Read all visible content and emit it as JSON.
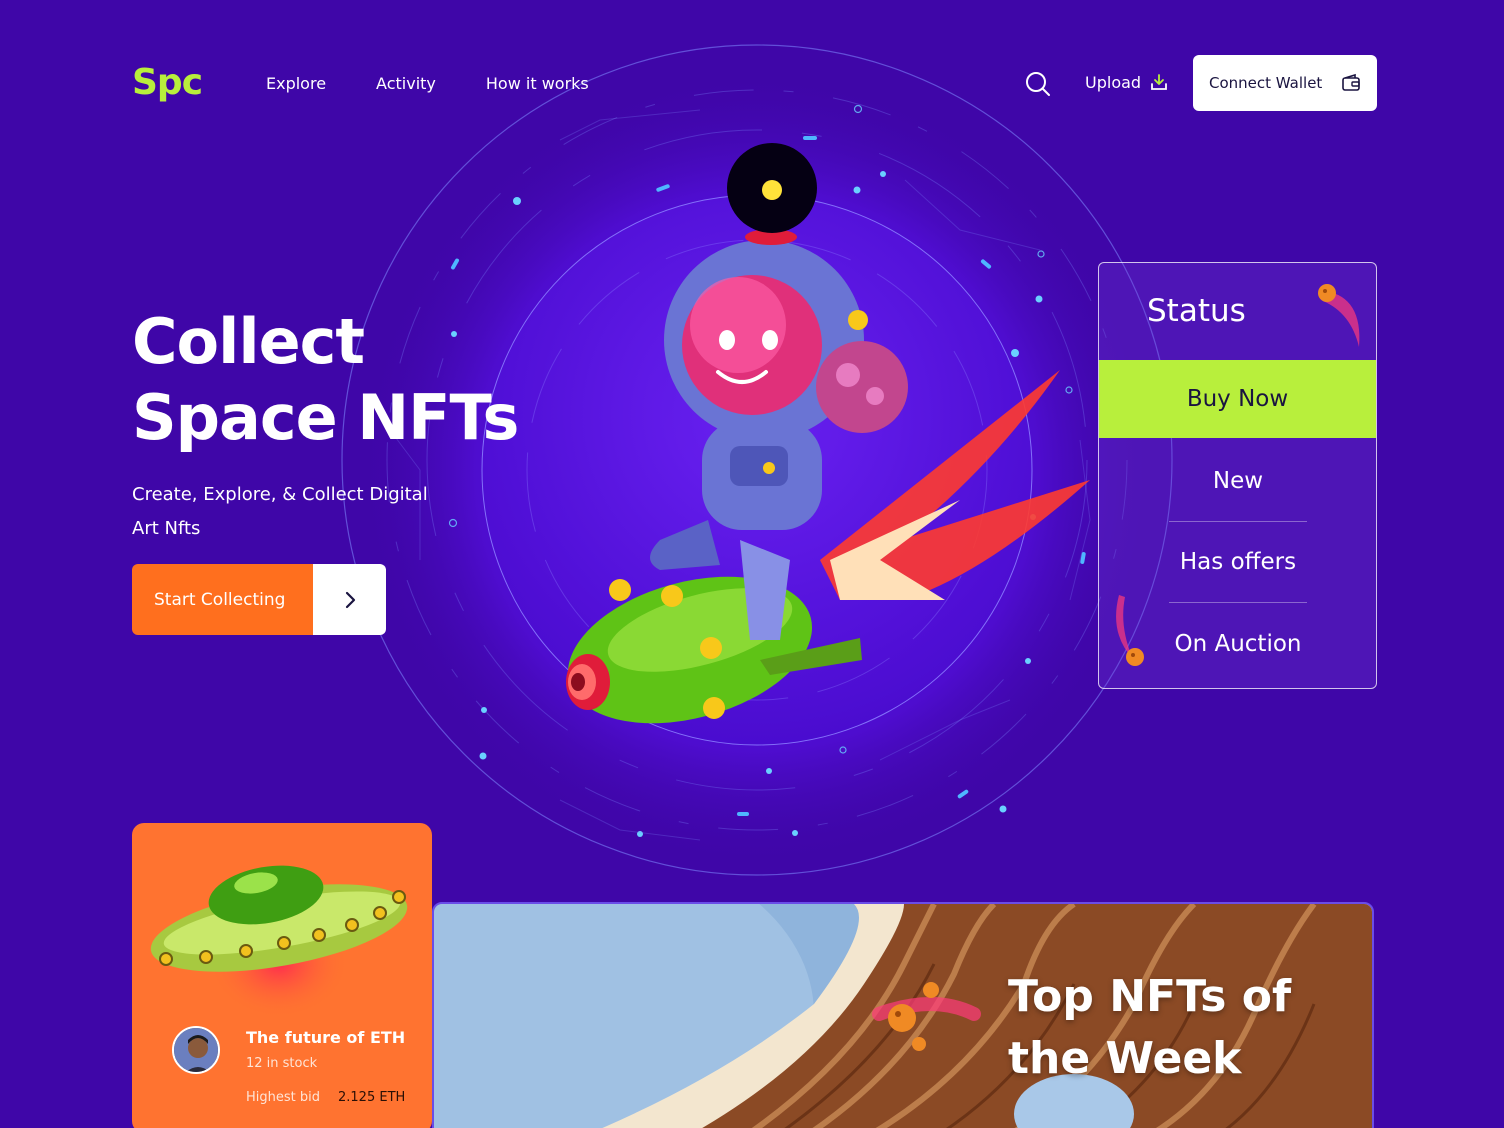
{
  "brand": {
    "logo": "Spc"
  },
  "nav": {
    "items": [
      "Explore",
      "Activity",
      "How it works"
    ]
  },
  "header": {
    "upload_label": "Upload",
    "wallet_label": "Connect Wallet"
  },
  "hero": {
    "title_line1": "Collect",
    "title_line2": "Space NFTs",
    "subtitle": "Create, Explore, & Collect Digital Art Nfts",
    "cta_label": "Start Collecting"
  },
  "status": {
    "title": "Status",
    "options": [
      "Buy Now",
      "New",
      "Has offers",
      "On Auction"
    ],
    "selected": "Buy Now"
  },
  "nft_card": {
    "name": "The future of ETH",
    "stock": "12 in stock",
    "bid_label": "Highest bid",
    "bid_value": "2.125 ETH"
  },
  "banner": {
    "title": "Top NFTs of the Week"
  },
  "colors": {
    "background": "#3f06a8",
    "accent_green": "#b8ef3c",
    "accent_orange": "#ff6f1e",
    "white": "#ffffff"
  },
  "icons": [
    "search-icon",
    "upload-icon",
    "wallet-icon",
    "chevron-right-icon"
  ]
}
